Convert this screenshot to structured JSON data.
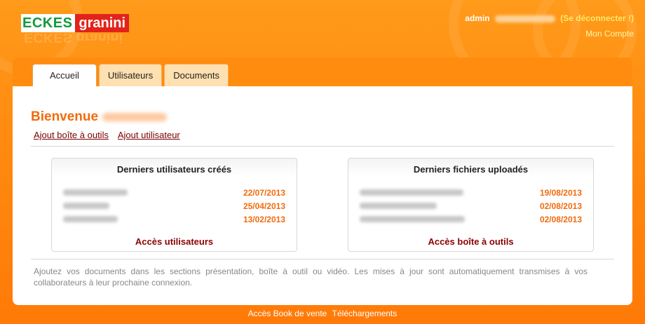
{
  "brand": {
    "part1": "ECKES",
    "part2": "granini"
  },
  "user": {
    "role": "admin",
    "logout_label": "(Se déconnecter !)",
    "account_label": "Mon Compte"
  },
  "tabs": [
    {
      "label": "Accueil"
    },
    {
      "label": "Utilisateurs"
    },
    {
      "label": "Documents"
    }
  ],
  "welcome": {
    "label": "Bienvenue"
  },
  "actions": [
    {
      "label": "Ajout boîte à outils"
    },
    {
      "label": "Ajout utilisateur"
    }
  ],
  "users_box": {
    "title": "Derniers utilisateurs créés",
    "rows": [
      {
        "date": "22/07/2013"
      },
      {
        "date": "25/04/2013"
      },
      {
        "date": "13/02/2013"
      }
    ],
    "link": "Accès utilisateurs"
  },
  "files_box": {
    "title": "Derniers fichiers uploadés",
    "rows": [
      {
        "date": "19/08/2013"
      },
      {
        "date": "02/08/2013"
      },
      {
        "date": "02/08/2013"
      }
    ],
    "link": "Accès boîte à outils"
  },
  "info_text": "Ajoutez vos documents dans les sections présentation, boîte à outil ou vidéo. Les mises à jour sont automatiquement transmises à vos collaborateurs à leur prochaine connexion.",
  "footer": {
    "link1": "Accès Book de vente",
    "link2": "Téléchargements"
  },
  "colors": {
    "orange_bg": "#ff8a10",
    "accent_orange": "#f26b0f",
    "dark_red_link": "#8b0000",
    "logo_green": "#139a3d",
    "logo_red": "#e2231a"
  }
}
